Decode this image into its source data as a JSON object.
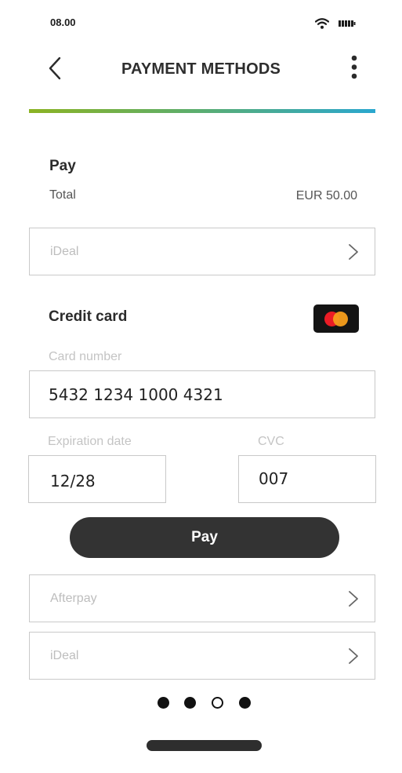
{
  "status_bar": {
    "time": "08.00"
  },
  "header": {
    "title": "PAYMENT METHODS"
  },
  "summary": {
    "heading": "Pay",
    "total_label": "Total",
    "total_value": "EUR 50.00"
  },
  "methods_top": [
    {
      "label": "iDeal"
    }
  ],
  "credit_card": {
    "heading": "Credit card",
    "brand": "mastercard",
    "card_number_label": "Card number",
    "card_number_value": "5432 1234 1000 4321",
    "expiration_label": "Expiration date",
    "expiration_value": "12/28",
    "cvc_label": "CVC",
    "cvc_value": "007",
    "pay_label": "Pay"
  },
  "methods_bottom": [
    {
      "label": "Afterpay"
    },
    {
      "label": "iDeal"
    }
  ],
  "pagination": {
    "total": 4,
    "active": 3
  },
  "colors": {
    "accent_start": "#8bb323",
    "accent_end": "#2aa7cf",
    "button": "#333333"
  }
}
